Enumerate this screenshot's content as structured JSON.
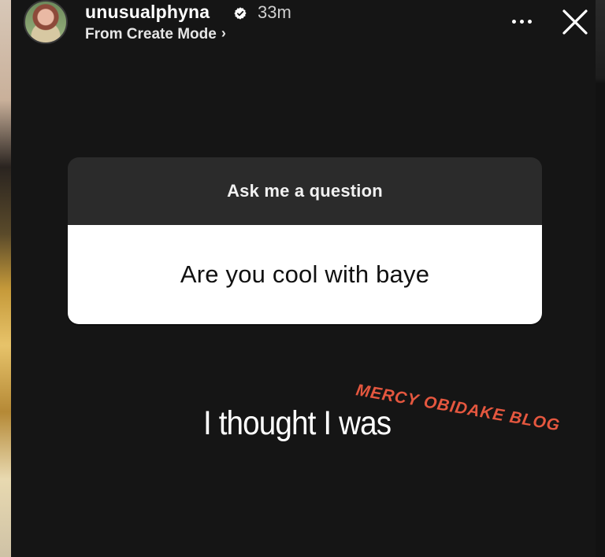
{
  "header": {
    "username": "unusualphyna",
    "time": "33m",
    "subtitle": "From Create Mode",
    "icons": {
      "verified": "verified-badge-icon",
      "more": "more-options-icon",
      "close": "close-icon",
      "chevron": "chevron-right-icon"
    }
  },
  "question_sticker": {
    "title": "Ask me a question",
    "question": "Are you cool with baye"
  },
  "answer": {
    "text": "I thought I was"
  },
  "watermark": {
    "text": "MERCY OBIDAKE BLOG",
    "color": "#e5573f"
  },
  "colors": {
    "background": "#151515",
    "sticker_header": "#2b2b2b",
    "sticker_body": "#ffffff",
    "primary_text": "#ffffff"
  }
}
